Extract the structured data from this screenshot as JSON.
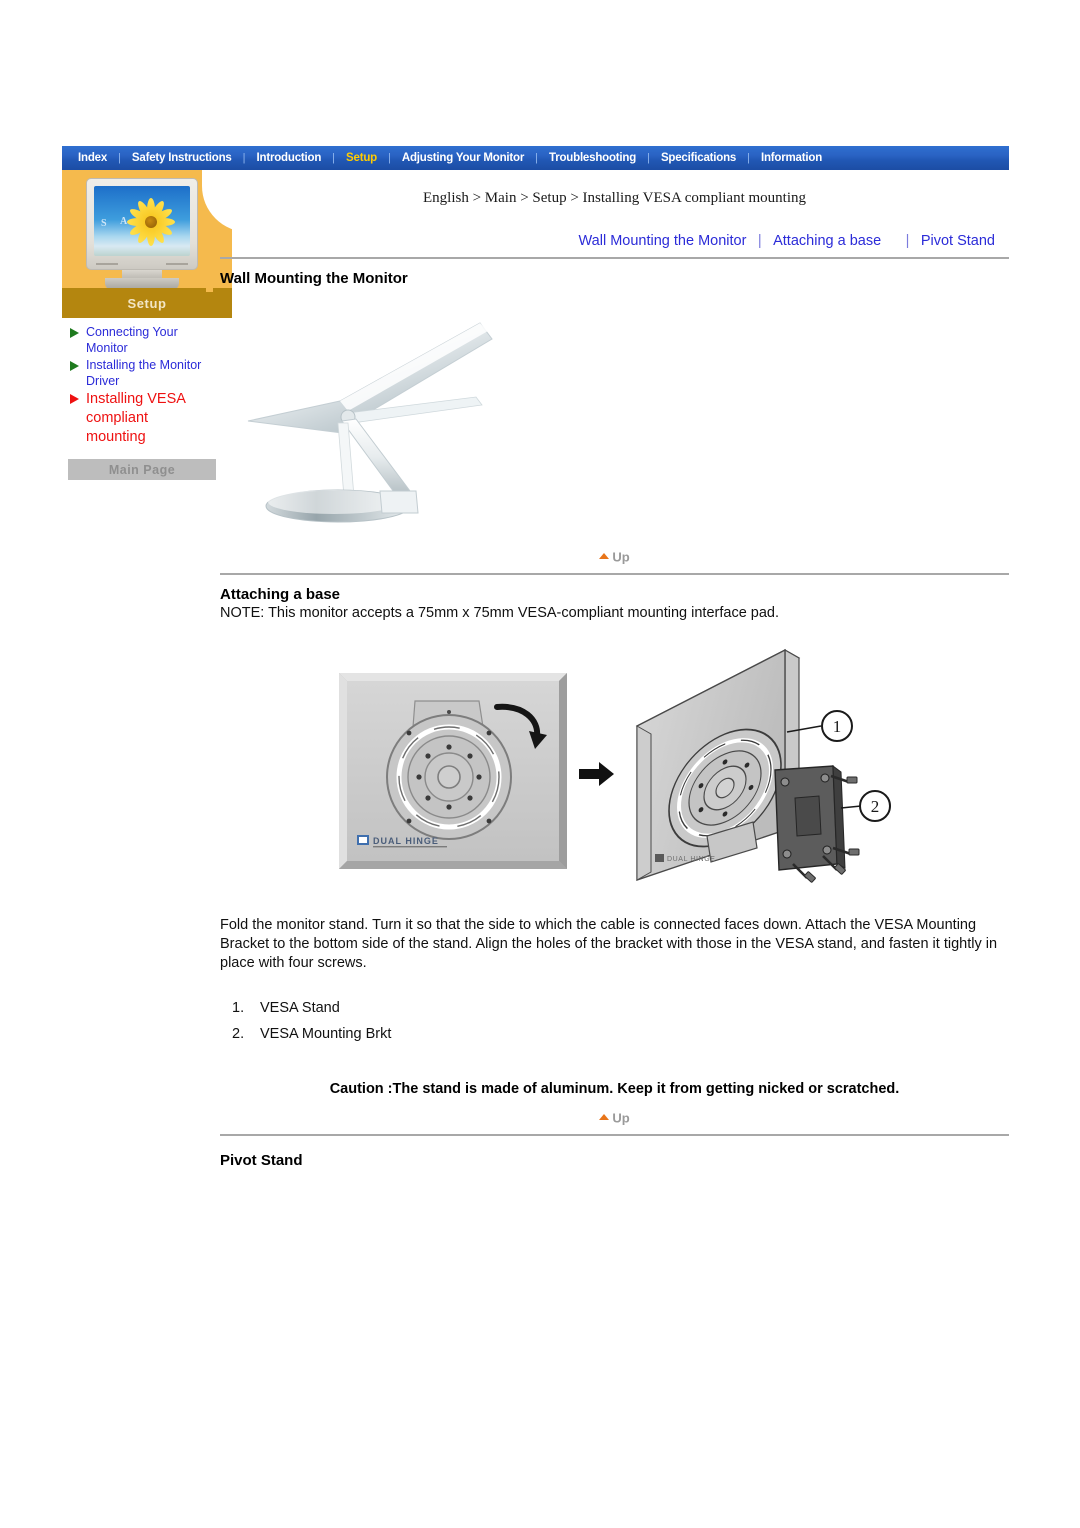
{
  "topnav": {
    "separator": "|",
    "items": [
      {
        "label": "Index",
        "active": false
      },
      {
        "label": "Safety Instructions",
        "active": false
      },
      {
        "label": "Introduction",
        "active": false
      },
      {
        "label": "Setup",
        "active": true
      },
      {
        "label": "Adjusting Your Monitor",
        "active": false
      },
      {
        "label": "Troubleshooting",
        "active": false
      },
      {
        "label": "Specifications",
        "active": false
      },
      {
        "label": "Information",
        "active": false
      }
    ]
  },
  "sidebar": {
    "logo_icon": "crt-monitor-sunflower-icon",
    "screen_letters": [
      "S",
      "A"
    ],
    "tab_label": "Setup",
    "items": [
      {
        "label": "Connecting Your Monitor",
        "bullet": "green-triangle-icon",
        "current": false
      },
      {
        "label": "Installing the Monitor Driver",
        "bullet": "green-triangle-icon",
        "current": false
      },
      {
        "label": "Installing VESA compliant mounting",
        "bullet": "red-triangle-icon",
        "current": true
      }
    ],
    "main_page_label": "Main Page"
  },
  "content": {
    "breadcrumb": "English > Main > Setup > Installing VESA compliant mounting",
    "section_links": [
      {
        "label": "Wall Mounting the Monitor"
      },
      {
        "label": "Attaching a base"
      },
      {
        "label": "Pivot Stand"
      }
    ],
    "section_link_separator": "|",
    "wall_mounting": {
      "heading": "Wall Mounting the Monitor",
      "figure_icon": "folded-monitor-stand-illustration"
    },
    "up_link": {
      "label": "Up",
      "icon": "up-triangle-icon"
    },
    "attaching_base": {
      "heading": "Attaching a base",
      "note": "NOTE: This monitor accepts a 75mm x 75mm VESA-compliant mounting interface pad.",
      "figure_left_icon": "dual-hinge-plate-photo",
      "figure_left_caption": "DUAL HINGE",
      "arrow_icon": "arrow-right-icon",
      "figure_right_icon": "vesa-bracket-assembly-diagram",
      "callout_1": "1",
      "callout_2": "2",
      "instructions": "Fold the monitor stand. Turn it so that the side to which the cable is connected faces down. Attach the VESA Mounting Bracket to the bottom side of the stand. Align the holes of the bracket with those in the VESA stand, and fasten it tightly in place with four screws.",
      "list": [
        {
          "num": "1.",
          "label": "VESA Stand"
        },
        {
          "num": "2.",
          "label": "VESA Mounting Brkt"
        }
      ],
      "caution": "Caution :The stand is made of aluminum. Keep it from getting nicked or scratched."
    },
    "pivot_stand": {
      "heading": "Pivot Stand"
    }
  },
  "colors": {
    "nav_blue": "#2157b4",
    "nav_active": "#ffcc00",
    "sidebar_orange": "#f5ba4d",
    "sidebar_tab_brown": "#b4860f",
    "link_blue": "#2b2bd8",
    "current_red": "#ee1111",
    "bullet_green": "#1e7a1e",
    "up_orange": "#e8751a",
    "rule_gray": "#a8a8a8"
  }
}
